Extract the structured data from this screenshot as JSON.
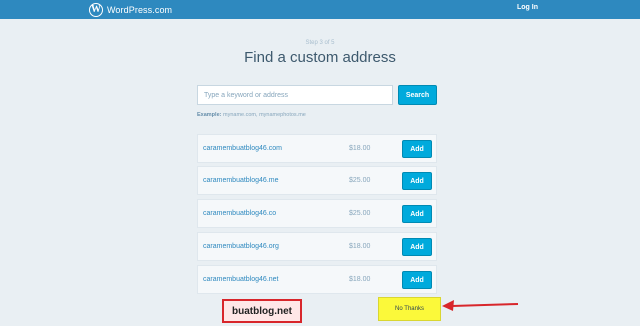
{
  "topbar": {
    "brand": "WordPress.com",
    "logo_letter": "W",
    "login_label": "Log In"
  },
  "header": {
    "step": "Step 3 of 5",
    "title": "Find a custom address"
  },
  "search": {
    "placeholder": "Type a keyword or address",
    "button_label": "Search",
    "example_label": "Example:",
    "example_text": "myname.com, mynamephotos.me"
  },
  "results": [
    {
      "domain": "caramembuatblog46.com",
      "price": "$18.00",
      "action": "Add"
    },
    {
      "domain": "caramembuatblog46.me",
      "price": "$25.00",
      "action": "Add"
    },
    {
      "domain": "caramembuatblog46.co",
      "price": "$25.00",
      "action": "Add"
    },
    {
      "domain": "caramembuatblog46.org",
      "price": "$18.00",
      "action": "Add"
    },
    {
      "domain": "caramembuatblog46.net",
      "price": "$18.00",
      "action": "Add"
    }
  ],
  "footer": {
    "no_thanks_label": "No Thanks",
    "watermark": "buatblog.net"
  },
  "colors": {
    "topbar": "#2e89bf",
    "background": "#e9eff3",
    "button": "#00aadc",
    "highlight": "#fbf93a",
    "annotation": "#d8262b"
  }
}
